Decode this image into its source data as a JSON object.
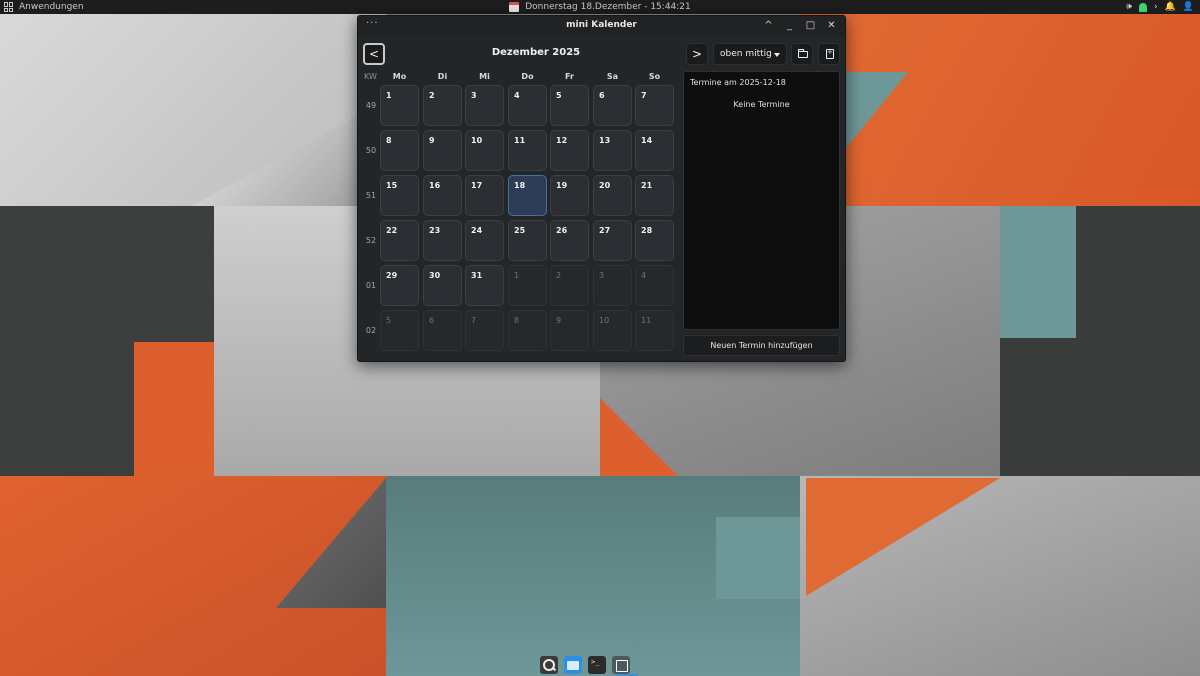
{
  "colors": {
    "orange": "#e0622f",
    "teal": "#6e9797",
    "grey_light": "#c4c4c4",
    "grey_dark": "#3f4242",
    "today_accent": "#4b6e9c",
    "dock_indicator": "#3a90d8"
  },
  "top_panel": {
    "apps_label": "Anwendungen",
    "clock": "Donnerstag 18.Dezember - 15:44:21",
    "tray_volume": "🕪",
    "tray_arrow": "›",
    "tray_bell": "🔔",
    "tray_user": "👤"
  },
  "window": {
    "menu_dots": "···",
    "title": "mini Kalender",
    "controls": {
      "shade": "^",
      "minimize": "_",
      "maximize": "□",
      "close": "✕"
    },
    "prev_label": "<",
    "next_label": ">",
    "month_title": "Dezember 2025",
    "time_select_value": "oben mittig",
    "kw_header": "KW",
    "weekdays": [
      "Mo",
      "Di",
      "Mi",
      "Do",
      "Fr",
      "Sa",
      "So"
    ],
    "weeks": [
      {
        "kw": "49",
        "days": [
          {
            "d": "1",
            "o": false
          },
          {
            "d": "2",
            "o": false
          },
          {
            "d": "3",
            "o": false
          },
          {
            "d": "4",
            "o": false
          },
          {
            "d": "5",
            "o": false
          },
          {
            "d": "6",
            "o": false
          },
          {
            "d": "7",
            "o": false
          }
        ]
      },
      {
        "kw": "50",
        "days": [
          {
            "d": "8",
            "o": false
          },
          {
            "d": "9",
            "o": false
          },
          {
            "d": "10",
            "o": false
          },
          {
            "d": "11",
            "o": false
          },
          {
            "d": "12",
            "o": false
          },
          {
            "d": "13",
            "o": false
          },
          {
            "d": "14",
            "o": false
          }
        ]
      },
      {
        "kw": "51",
        "days": [
          {
            "d": "15",
            "o": false
          },
          {
            "d": "16",
            "o": false
          },
          {
            "d": "17",
            "o": false
          },
          {
            "d": "18",
            "o": false,
            "today": true
          },
          {
            "d": "19",
            "o": false
          },
          {
            "d": "20",
            "o": false
          },
          {
            "d": "21",
            "o": false
          }
        ]
      },
      {
        "kw": "52",
        "days": [
          {
            "d": "22",
            "o": false
          },
          {
            "d": "23",
            "o": false
          },
          {
            "d": "24",
            "o": false
          },
          {
            "d": "25",
            "o": false
          },
          {
            "d": "26",
            "o": false
          },
          {
            "d": "27",
            "o": false
          },
          {
            "d": "28",
            "o": false
          }
        ]
      },
      {
        "kw": "01",
        "days": [
          {
            "d": "29",
            "o": false
          },
          {
            "d": "30",
            "o": false
          },
          {
            "d": "31",
            "o": false
          },
          {
            "d": "1",
            "o": true
          },
          {
            "d": "2",
            "o": true
          },
          {
            "d": "3",
            "o": true
          },
          {
            "d": "4",
            "o": true
          }
        ]
      },
      {
        "kw": "02",
        "days": [
          {
            "d": "5",
            "o": true
          },
          {
            "d": "6",
            "o": true
          },
          {
            "d": "7",
            "o": true
          },
          {
            "d": "8",
            "o": true
          },
          {
            "d": "9",
            "o": true
          },
          {
            "d": "10",
            "o": true
          },
          {
            "d": "11",
            "o": true
          }
        ]
      }
    ],
    "events_title": "Termine am 2025-12-18",
    "events_empty": "Keine Termine",
    "add_button": "Neuen Termin hinzufügen"
  },
  "dock": {
    "terminal_glyph": ">_"
  }
}
